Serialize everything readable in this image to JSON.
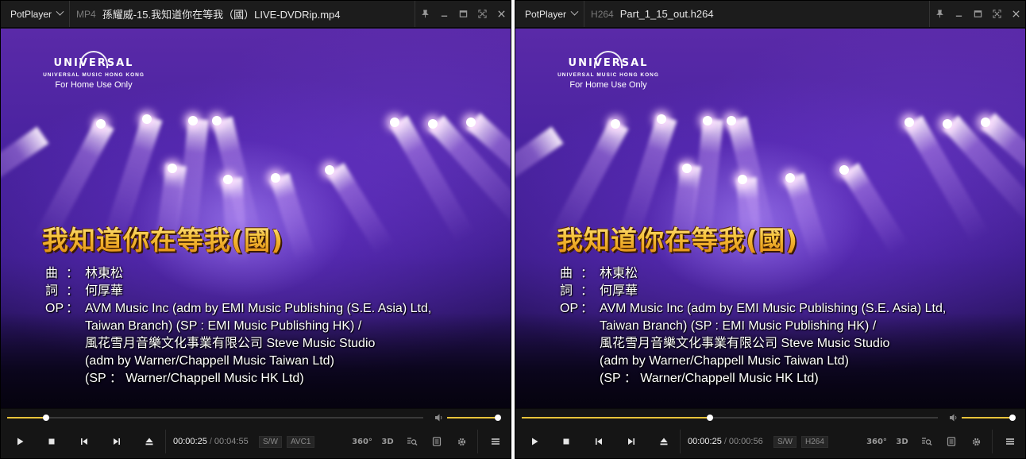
{
  "players": [
    {
      "app_name": "PotPlayer",
      "format": "MP4",
      "filename": "孫耀威-15.我知道你在等我（國）LIVE-DVDRip.mp4",
      "logo": {
        "word": "UNIVERSAL",
        "sub": "UNIVERSAL MUSIC HONG KONG",
        "home": "For Home Use Only"
      },
      "song_title": "我知道你在等我(國)",
      "credits": [
        {
          "label": "曲",
          "colon": "：",
          "text": "林東松"
        },
        {
          "label": "詞",
          "colon": "：",
          "text": "何厚華"
        },
        {
          "label": "OP",
          "colon": "：",
          "text": "AVM Music Inc (adm by EMI Music Publishing (S.E. Asia) Ltd,"
        }
      ],
      "credits_cont": [
        "Taiwan Branch) (SP : EMI Music Publishing HK) /",
        "風花雪月音樂文化事業有限公司 Steve Music Studio",
        "(adm by Warner/Chappell Music Taiwan Ltd)",
        "(SP ： Warner/Chappell Music HK Ltd)"
      ],
      "current_time": "00:00:25",
      "total_time": "00:04:55",
      "seek_progress": 0.094,
      "volume": 1.0,
      "badges": [
        "S/W",
        "AVC1"
      ],
      "icons": {
        "vr": "360°",
        "3d": "3D"
      }
    },
    {
      "app_name": "PotPlayer",
      "format": "H264",
      "filename": "Part_1_15_out.h264",
      "logo": {
        "word": "UNIVERSAL",
        "sub": "UNIVERSAL MUSIC HONG KONG",
        "home": "For Home Use Only"
      },
      "song_title": "我知道你在等我(國)",
      "credits": [
        {
          "label": "曲",
          "colon": "：",
          "text": "林東松"
        },
        {
          "label": "詞",
          "colon": "：",
          "text": "何厚華"
        },
        {
          "label": "OP",
          "colon": "：",
          "text": "AVM Music Inc (adm by EMI Music Publishing (S.E. Asia) Ltd,"
        }
      ],
      "credits_cont": [
        "Taiwan Branch) (SP : EMI Music Publishing HK) /",
        "風花雪月音樂文化事業有限公司 Steve Music Studio",
        "(adm by Warner/Chappell Music Taiwan Ltd)",
        "(SP ： Warner/Chappell Music HK Ltd)"
      ],
      "current_time": "00:00:25",
      "total_time": "00:00:56",
      "seek_progress": 0.452,
      "volume": 1.0,
      "badges": [
        "S/W",
        "H264"
      ],
      "icons": {
        "vr": "360°",
        "3d": "3D"
      }
    }
  ],
  "colors": {
    "accent": "#e8c33a",
    "title_gold": "#f6c23a",
    "bg_bar": "#151515"
  }
}
